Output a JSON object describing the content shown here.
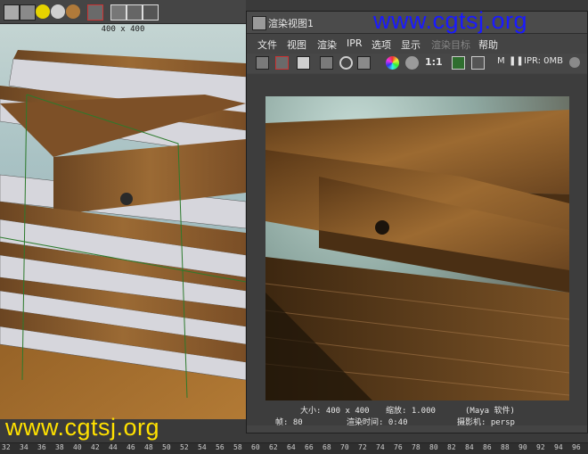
{
  "watermarks": {
    "top": "www.cgtsj.org",
    "bottom": "www.cgtsj.org"
  },
  "viewport": {
    "resolution_label": "400 x 400"
  },
  "render_window": {
    "title": "渲染视图1",
    "menu": [
      {
        "label": "文件",
        "disabled": false
      },
      {
        "label": "视图",
        "disabled": false
      },
      {
        "label": "渲染",
        "disabled": false
      },
      {
        "label": "IPR",
        "disabled": false
      },
      {
        "label": "选项",
        "disabled": false
      },
      {
        "label": "显示",
        "disabled": false
      },
      {
        "label": "渲染目标",
        "disabled": true
      },
      {
        "label": "帮助",
        "disabled": false
      }
    ],
    "toolbar": {
      "ratio": "1:1",
      "m_label": "M",
      "ipr_memory": "IPR: 0MB"
    },
    "info": {
      "size": "大小: 400 x 400",
      "zoom": "缩放: 1.000",
      "renderer": "(Maya 软件)",
      "frame": "帧: 80",
      "render_time": "渲染时间: 0:40",
      "camera": "摄影机: persp"
    }
  },
  "timeline": {
    "ticks": [
      "32",
      "34",
      "36",
      "38",
      "40",
      "42",
      "44",
      "46",
      "48",
      "50",
      "52",
      "54",
      "56",
      "58",
      "60",
      "62",
      "64",
      "66",
      "68",
      "70",
      "72",
      "74",
      "76",
      "78",
      "80",
      "82",
      "84",
      "86",
      "88",
      "90",
      "92",
      "94",
      "96"
    ]
  },
  "colors": {
    "watermark_top": "#1a1aff",
    "watermark_bottom": "#ffe100",
    "wood": "#8a5a2b"
  }
}
